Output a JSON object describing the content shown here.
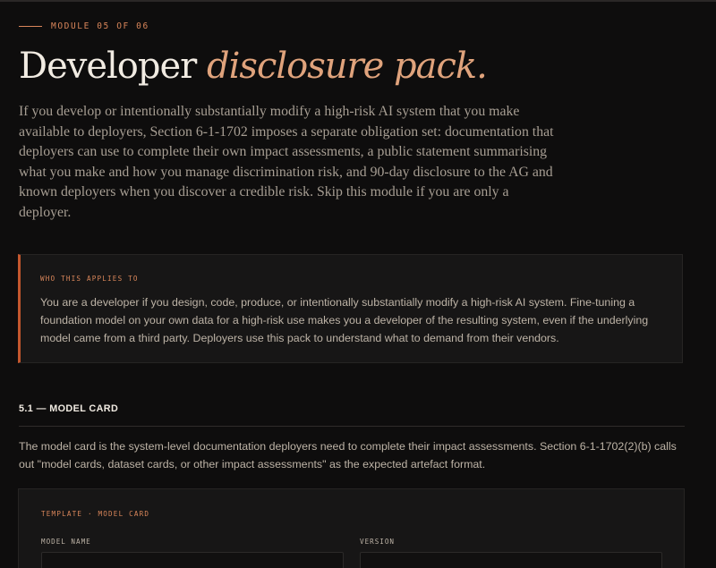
{
  "module": {
    "eyebrow": "MODULE 05 OF 06",
    "title_plain": "Developer",
    "title_accent": "disclosure pack.",
    "intro": "If you develop or intentionally substantially modify a high-risk AI system that you make available to deployers, Section 6-1-1702 imposes a separate obligation set: documentation that deployers can use to complete their own impact assessments, a public statement summarising what you make and how you manage discrimination risk, and 90-day disclosure to the AG and known deployers when you discover a credible risk. Skip this module if you are only a deployer."
  },
  "callout": {
    "label": "WHO THIS APPLIES TO",
    "body": "You are a developer if you design, code, produce, or intentionally substantially modify a high-risk AI system. Fine-tuning a foundation model on your own data for a high-risk use makes you a developer of the resulting system, even if the underlying model came from a third party. Deployers use this pack to understand what to demand from their vendors."
  },
  "section": {
    "title": "5.1 — MODEL CARD",
    "body": "The model card is the system-level documentation deployers need to complete their impact assessments. Section 6-1-1702(2)(b) calls out \"model cards, dataset cards, or other impact assessments\" as the expected artefact format."
  },
  "template": {
    "label": "TEMPLATE · MODEL CARD",
    "fields": [
      {
        "label": "MODEL NAME",
        "value": ""
      },
      {
        "label": "VERSION",
        "value": ""
      }
    ]
  },
  "colors": {
    "background": "#0e0d0d",
    "accent": "#d9865a",
    "title_accent": "#e0a37c",
    "callout_border": "#c4572e",
    "panel": "#171616"
  }
}
